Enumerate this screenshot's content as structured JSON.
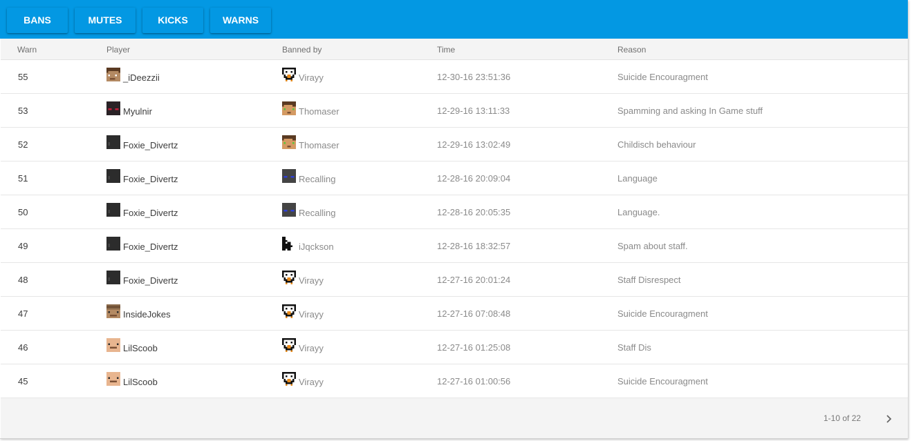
{
  "tabs": [
    {
      "label": "BANS"
    },
    {
      "label": "MUTES"
    },
    {
      "label": "KICKS"
    },
    {
      "label": "WARNS"
    }
  ],
  "columns": {
    "id": "Warn",
    "player": "Player",
    "by": "Banned by",
    "time": "Time",
    "reason": "Reason"
  },
  "rows": [
    {
      "id": "55",
      "player": "_iDeezzii",
      "player_skin": "brown-hair",
      "by": "Virayy",
      "by_skin": "penguin",
      "time": "12-30-16 23:51:36",
      "reason": "Suicide Encouragment"
    },
    {
      "id": "53",
      "player": "Myulnir",
      "player_skin": "dark-red-eyes",
      "by": "Thomaser",
      "by_skin": "steve-green-eyes",
      "time": "12-29-16 13:11:33",
      "reason": "Spamming and asking In Game stuff"
    },
    {
      "id": "52",
      "player": "Foxie_Divertz",
      "player_skin": "dark",
      "by": "Thomaser",
      "by_skin": "steve-green-eyes",
      "time": "12-29-16 13:02:49",
      "reason": "Childisch behaviour"
    },
    {
      "id": "51",
      "player": "Foxie_Divertz",
      "player_skin": "dark",
      "by": "Recalling",
      "by_skin": "grey-blue-eyes",
      "time": "12-28-16 20:09:04",
      "reason": "Language"
    },
    {
      "id": "50",
      "player": "Foxie_Divertz",
      "player_skin": "dark",
      "by": "Recalling",
      "by_skin": "grey-blue-eyes",
      "time": "12-28-16 20:05:35",
      "reason": "Language."
    },
    {
      "id": "49",
      "player": "Foxie_Divertz",
      "player_skin": "dark",
      "by": "iJqckson",
      "by_skin": "black-white",
      "time": "12-28-16 18:32:57",
      "reason": "Spam about staff."
    },
    {
      "id": "48",
      "player": "Foxie_Divertz",
      "player_skin": "dark",
      "by": "Virayy",
      "by_skin": "penguin",
      "time": "12-27-16 20:01:24",
      "reason": "Staff Disrespect"
    },
    {
      "id": "47",
      "player": "InsideJokes",
      "player_skin": "tan-hat",
      "by": "Virayy",
      "by_skin": "penguin",
      "time": "12-27-16 07:08:48",
      "reason": "Suicide Encouragment"
    },
    {
      "id": "46",
      "player": "LilScoob",
      "player_skin": "skin-face",
      "by": "Virayy",
      "by_skin": "penguin",
      "time": "12-27-16 01:25:08",
      "reason": "Staff Dis"
    },
    {
      "id": "45",
      "player": "LilScoob",
      "player_skin": "skin-face",
      "by": "Virayy",
      "by_skin": "penguin",
      "time": "12-27-16 01:00:56",
      "reason": "Suicide Encouragment"
    }
  ],
  "pagination": {
    "range": "1-10 of 22",
    "next_icon": "chevron-right-icon"
  },
  "colors": {
    "toolbar": "#0398e3",
    "header_bg": "#f4f4f4"
  }
}
